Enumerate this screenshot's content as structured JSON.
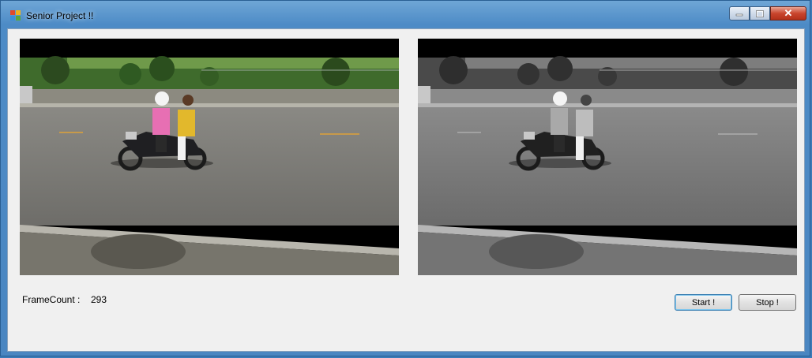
{
  "window": {
    "title": "Senior Project !!",
    "icon": "app-grid-icon",
    "controls": {
      "minimize_icon": "minimize-icon",
      "maximize_icon": "maximize-icon",
      "close_icon": "close-icon",
      "close_glyph": "✕"
    }
  },
  "views": [
    {
      "name": "original-color-frame",
      "mode": "color"
    },
    {
      "name": "grayscale-frame",
      "mode": "grayscale"
    }
  ],
  "status": {
    "frame_count_label": "FrameCount :",
    "frame_count_value": "293"
  },
  "buttons": {
    "start_label": "Start !",
    "stop_label": "Stop !"
  },
  "colors": {
    "accent": "#3c7fb1",
    "close": "#c9452d"
  }
}
